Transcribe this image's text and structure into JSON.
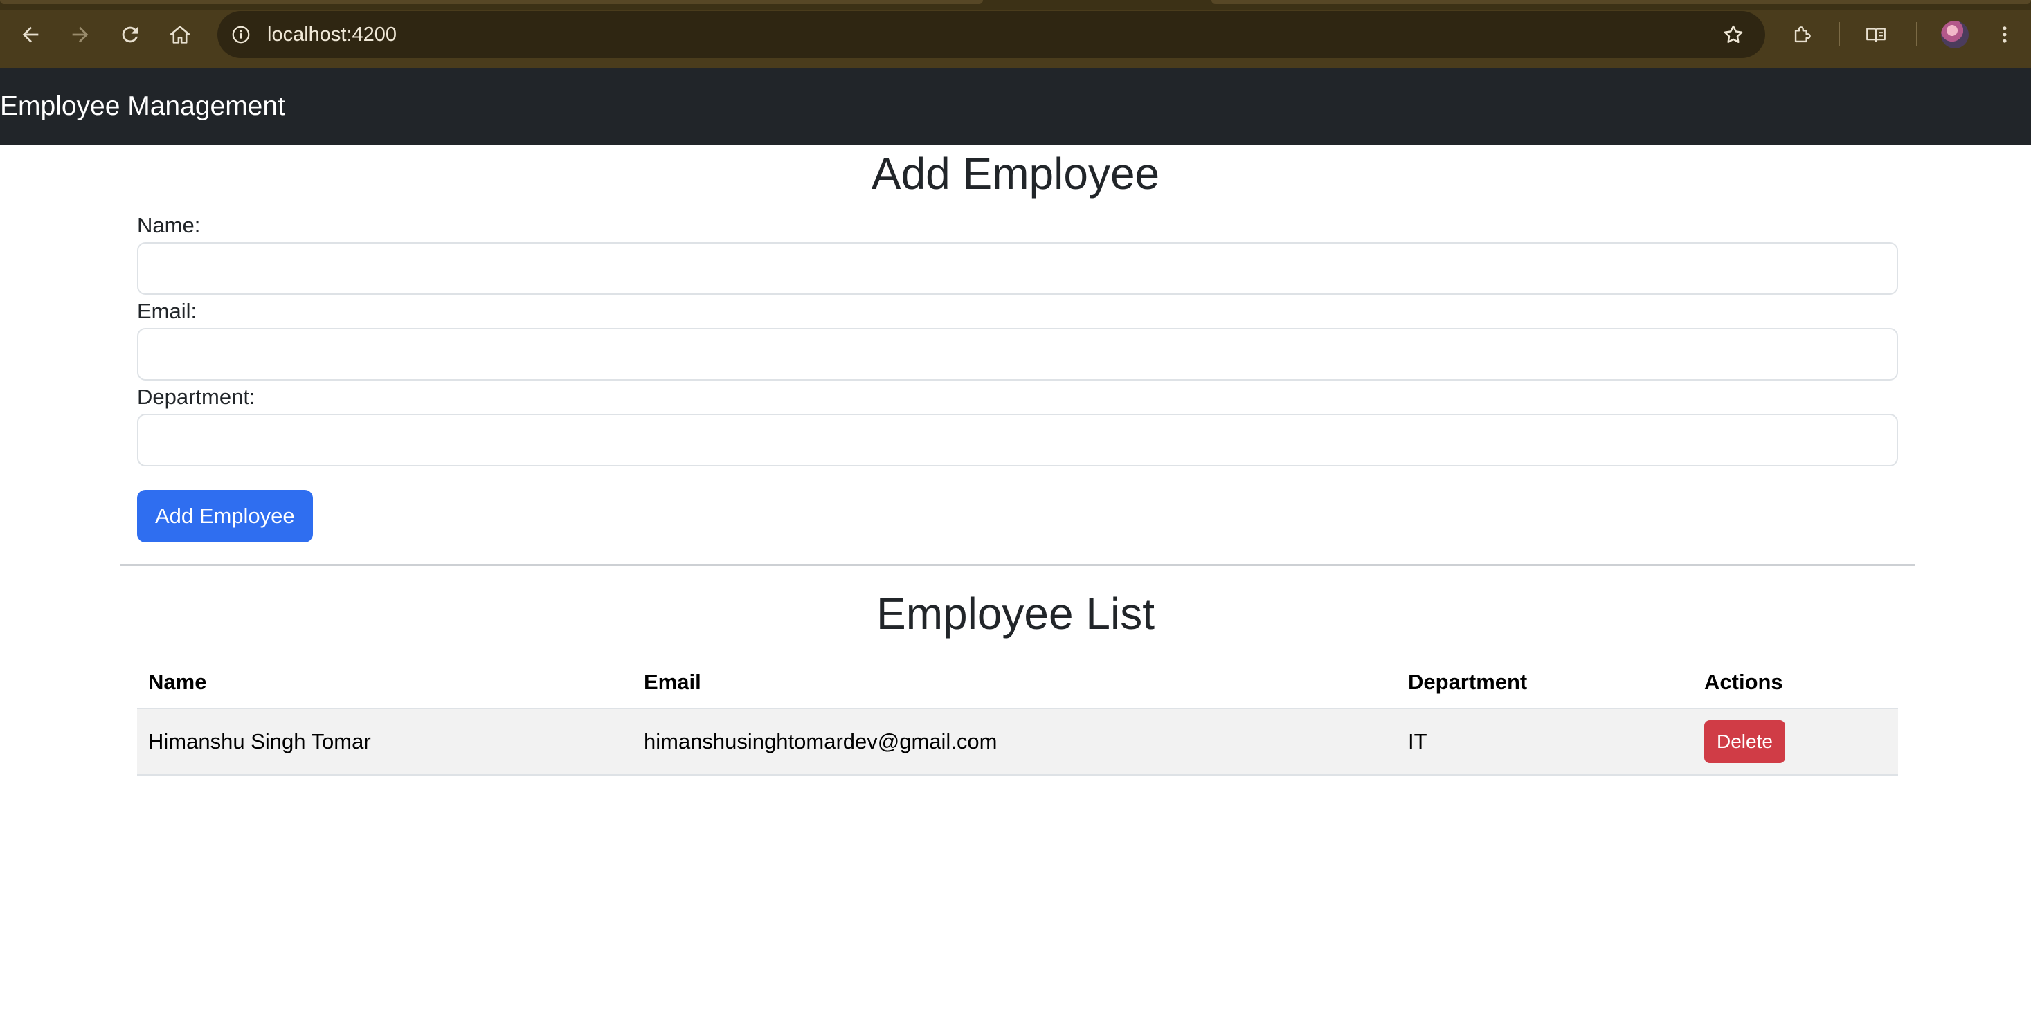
{
  "browser": {
    "url": "localhost:4200",
    "icons": {
      "back": "back-arrow-icon",
      "forward": "forward-arrow-icon",
      "reload": "reload-icon",
      "home": "home-icon",
      "site_info": "info-icon",
      "bookmark": "star-icon",
      "extensions": "puzzle-icon",
      "reading_list": "reading-list-icon",
      "profile": "avatar",
      "menu": "kebab-menu-icon"
    },
    "colors": {
      "frame": "#4a3c1c",
      "omnibox": "#2f2612"
    }
  },
  "navbar": {
    "brand": "Employee Management",
    "background": "#212529"
  },
  "form": {
    "title": "Add Employee",
    "fields": [
      {
        "label": "Name:",
        "value": ""
      },
      {
        "label": "Email:",
        "value": ""
      },
      {
        "label": "Department:",
        "value": ""
      }
    ],
    "submit_label": "Add Employee",
    "accent": "#2f6ef0"
  },
  "list": {
    "title": "Employee List",
    "columns": [
      "Name",
      "Email",
      "Department",
      "Actions"
    ],
    "rows": [
      {
        "name": "Himanshu Singh Tomar",
        "email": "himanshusinghtomardev@gmail.com",
        "department": "IT",
        "action_label": "Delete"
      }
    ],
    "danger": "#d03c46"
  }
}
